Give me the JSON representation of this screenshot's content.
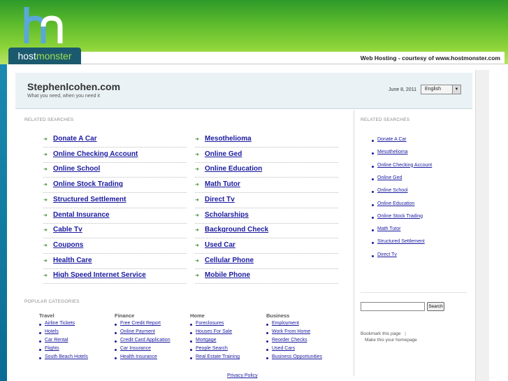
{
  "header": {
    "logo_host": "host",
    "logo_monster": "monster",
    "courtesy": "Web Hosting - courtesy of www.hostmonster.com"
  },
  "site": {
    "title": "Stephenlcohen.com",
    "tagline": "What you need, when you need it",
    "date": "June 8, 2011",
    "language": "English"
  },
  "main": {
    "related_label": "RELATED SEARCHES",
    "left_keywords": [
      "Donate A Car",
      "Online Checking Account",
      "Online School",
      "Online Stock Trading",
      "Structured Settlement",
      "Dental Insurance",
      "Cable Tv",
      "Coupons",
      "Health Care",
      "High Speed Internet Service"
    ],
    "right_keywords": [
      "Mesothelioma",
      "Online Ged",
      "Online Education",
      "Math Tutor",
      "Direct Tv",
      "Scholarships",
      "Background Check",
      "Used Car",
      "Cellular Phone",
      "Mobile Phone"
    ]
  },
  "sidebar": {
    "related_label": "RELATED SEARCHES",
    "links": [
      "Donate A Car",
      "Mesothelioma",
      "Online Checking Account",
      "Online Ged",
      "Online School",
      "Online Education",
      "Online Stock Trading",
      "Math Tutor",
      "Structured Settlement",
      "Direct Tv"
    ],
    "search_button": "Search",
    "bookmark": "Bookmark this page",
    "homepage": "Make this your homepage"
  },
  "popular": {
    "label": "POPULAR CATEGORIES",
    "categories": [
      {
        "name": "Travel",
        "links": [
          "Airline Tickets",
          "Hotels",
          "Car Rental",
          "Flights",
          "South Beach Hotels"
        ]
      },
      {
        "name": "Finance",
        "links": [
          "Free Credit Report",
          "Online Payment",
          "Credit Card Application",
          "Car Insurance",
          "Health Insurance"
        ]
      },
      {
        "name": "Home",
        "links": [
          "Foreclosures",
          "Houses For Sale",
          "Mortgage",
          "People Search",
          "Real Estate Training"
        ]
      },
      {
        "name": "Business",
        "links": [
          "Employment",
          "Work From Home",
          "Reorder Checks",
          "Used Cars",
          "Business Opportunities"
        ]
      }
    ]
  },
  "footer": {
    "privacy": "Privacy Policy"
  },
  "colors": {
    "link": "#1a1aa0",
    "header_green": "#5ab92c",
    "logo_box": "#1b5a6e",
    "page_bg": "#0a7aa0"
  }
}
